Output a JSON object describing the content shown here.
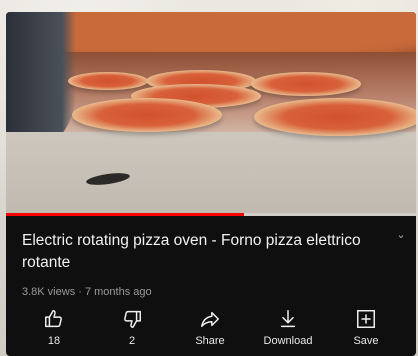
{
  "video": {
    "title": "Electric rotating pizza oven - Forno pizza elettrico rotante",
    "meta": "3.8K views · 7 months ago",
    "progress": 0.58
  },
  "actions": [
    {
      "label": "18",
      "icon": "thumbs-up-icon"
    },
    {
      "label": "2",
      "icon": "thumbs-down-icon"
    },
    {
      "label": "Share",
      "icon": "share-icon"
    },
    {
      "label": "Download",
      "icon": "download-icon"
    },
    {
      "label": "Save",
      "icon": "save-to-playlist-icon"
    }
  ],
  "colors": {
    "background": "#0f0f0f",
    "progress": "#ff0000",
    "text": "#f1f1f1",
    "meta": "#9a9a9a"
  }
}
